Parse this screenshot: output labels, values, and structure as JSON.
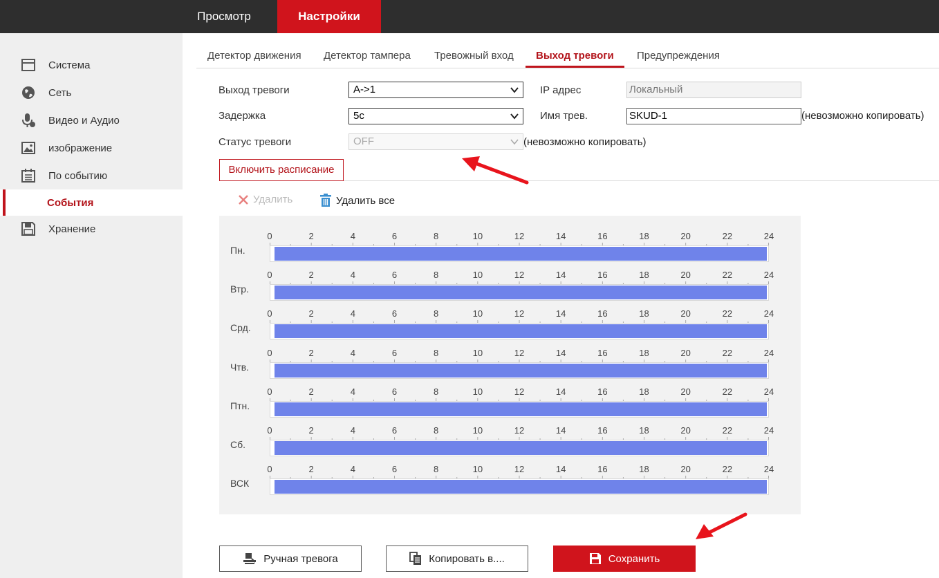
{
  "topbar": {
    "view": "Просмотр",
    "settings": "Настройки"
  },
  "sidebar": {
    "items": [
      {
        "label": "Система",
        "icon": "window-icon"
      },
      {
        "label": "Сеть",
        "icon": "globe-icon"
      },
      {
        "label": "Видео и Аудио",
        "icon": "microphone-icon"
      },
      {
        "label": "изображение",
        "icon": "image-icon"
      },
      {
        "label": "По событию",
        "icon": "calendar-icon"
      },
      {
        "label": "События",
        "icon": ""
      },
      {
        "label": "Хранение",
        "icon": "floppy-icon"
      }
    ]
  },
  "tabs": [
    "Детектор движения",
    "Детектор тампера",
    "Тревожный вход",
    "Выход тревоги",
    "Предупреждения"
  ],
  "form": {
    "output_label": "Выход тревоги",
    "output_value": "A->1",
    "delay_label": "Задержка",
    "delay_value": "5с",
    "status_label": "Статус тревоги",
    "status_value": "OFF",
    "status_note": "(невозможно копировать)",
    "ip_label": "IP адрес",
    "ip_value": "Локальный",
    "name_label": "Имя трев.",
    "name_value": "SKUD-1",
    "name_note": "(невозможно копировать)"
  },
  "schedule": {
    "enable_button": "Включить расписание",
    "delete_label": "Удалить",
    "delete_all_label": "Удалить все",
    "ticks": [
      "0",
      "2",
      "4",
      "6",
      "8",
      "10",
      "12",
      "14",
      "16",
      "18",
      "20",
      "22",
      "24"
    ],
    "days": [
      {
        "label": "Пн.",
        "ranges": [
          [
            0,
            24
          ]
        ]
      },
      {
        "label": "Втр.",
        "ranges": [
          [
            0,
            24
          ]
        ]
      },
      {
        "label": "Срд.",
        "ranges": [
          [
            0,
            24
          ]
        ]
      },
      {
        "label": "Чтв.",
        "ranges": [
          [
            0,
            24
          ]
        ]
      },
      {
        "label": "Птн.",
        "ranges": [
          [
            0,
            24
          ]
        ]
      },
      {
        "label": "Сб.",
        "ranges": [
          [
            0,
            24
          ]
        ]
      },
      {
        "label": "ВСК",
        "ranges": [
          [
            0,
            24
          ]
        ]
      }
    ],
    "fill_color": "#6f83ea"
  },
  "buttons": {
    "manual": "Ручная тревога",
    "copy": "Копировать в....",
    "save": "Сохранить"
  },
  "colors": {
    "accent": "#d0141c",
    "arrow": "#e8141c"
  }
}
